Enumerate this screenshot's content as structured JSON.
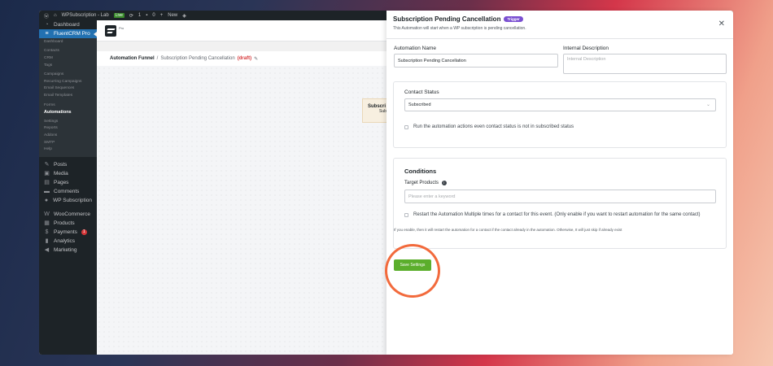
{
  "adminbar": {
    "site": "WPSubscription - Lab",
    "live": "Live",
    "updates": "1",
    "comments": "0",
    "new": "New"
  },
  "sidebar": {
    "dashboard": "Dashboard",
    "fluentcrm": "FluentCRM Pro",
    "submenu": [
      "Dashboard",
      "Contacts",
      "CRM",
      "Tags",
      "Campaigns",
      "Recurring Campaigns",
      "Email Sequences",
      "Email Templates",
      "Forms",
      "Automations",
      "Settings",
      "Reports",
      "Addons",
      "SMTP",
      "Help"
    ],
    "posts": "Posts",
    "media": "Media",
    "pages": "Pages",
    "comments": "Comments",
    "wpsubscription": "WP Subscription",
    "woocommerce": "WooCommerce",
    "products": "Products",
    "payments": "Payments",
    "payments_badge": "1",
    "analytics": "Analytics",
    "marketing": "Marketing"
  },
  "topstrip": {
    "logo_text": "Pro"
  },
  "breadcrumb": {
    "root": "Automation Funnel",
    "sep": "/",
    "current": "Subscription Pending Cancellation",
    "status": "(draft)"
  },
  "canvas": {
    "trigger_title": "Subscri",
    "trigger_sub": "Subs"
  },
  "panel": {
    "title": "Subscription Pending Cancellation",
    "badge": "Trigger",
    "description": "This Automation will start when a WP subscription is pending cancellation.",
    "automation_name_label": "Automation Name",
    "automation_name_value": "Subscription Pending Cancellation",
    "internal_desc_label": "Internal Description",
    "internal_desc_placeholder": "Internal Description",
    "contact_status_label": "Contact Status",
    "contact_status_value": "Subscribed",
    "run_anyway_label": "Run the automation actions even contact status is not in subscribed status",
    "conditions_title": "Conditions",
    "target_products_label": "Target Products",
    "target_products_placeholder": "Please enter a keyword",
    "restart_label": "Restart the Automation Multiple times for a contact for this event. (Only enable if you want to restart automation for the same contact)",
    "restart_help": "If you enable, then it will restart the automation for a contact if the contact already in the automation. Otherwise, It will just skip if already exist",
    "save_label": "Save Settings"
  },
  "colors": {
    "accent": "#2271b1",
    "save": "#5bae2c",
    "highlight": "#f26a3c",
    "badge": "#7a4fd1"
  }
}
